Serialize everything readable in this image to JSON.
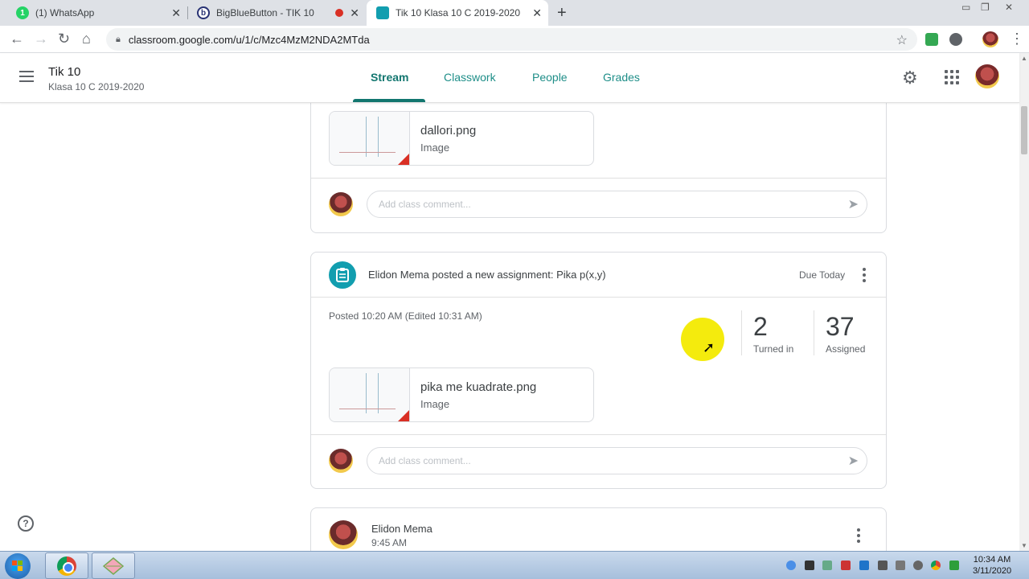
{
  "browser": {
    "tabs": [
      {
        "title": "(1) WhatsApp",
        "active": false
      },
      {
        "title": "BigBlueButton - TIK 10",
        "active": false
      },
      {
        "title": "Tik 10 Klasa 10 C 2019-2020",
        "active": true
      }
    ],
    "url": "classroom.google.com/u/1/c/Mzc4MzM2NDA2MTda"
  },
  "course": {
    "title": "Tik 10",
    "subtitle": "Klasa 10 C 2019-2020"
  },
  "nav": {
    "tabs": [
      {
        "label": "Stream",
        "active": true
      },
      {
        "label": "Classwork",
        "active": false
      },
      {
        "label": "People",
        "active": false
      },
      {
        "label": "Grades",
        "active": false
      }
    ]
  },
  "stream": {
    "first_post": {
      "attachment": {
        "name": "dallori.png",
        "type": "Image"
      },
      "comment_placeholder": "Add class comment..."
    },
    "assignment": {
      "title": "Elidon Mema posted a new assignment: Pika p(x,y)",
      "due": "Due Today",
      "posted": "Posted 10:20 AM (Edited 10:31 AM)",
      "turned_in": "2",
      "turned_in_label": "Turned in",
      "assigned": "37",
      "assigned_label": "Assigned",
      "attachment": {
        "name": "pika me kuadrate.png",
        "type": "Image"
      },
      "comment_placeholder": "Add class comment..."
    },
    "announcement": {
      "author": "Elidon Mema",
      "time": "9:45 AM"
    }
  },
  "taskbar": {
    "time": "10:34 AM",
    "date": "3/11/2020"
  },
  "colors": {
    "accent": "#12766f",
    "assignment_icon": "#129eaf",
    "cursor_highlight": "#f3ea00"
  },
  "icons": [
    "menu-icon",
    "gear-icon",
    "apps-icon",
    "send-icon",
    "assignment-icon",
    "more-vert-icon",
    "help-icon"
  ]
}
